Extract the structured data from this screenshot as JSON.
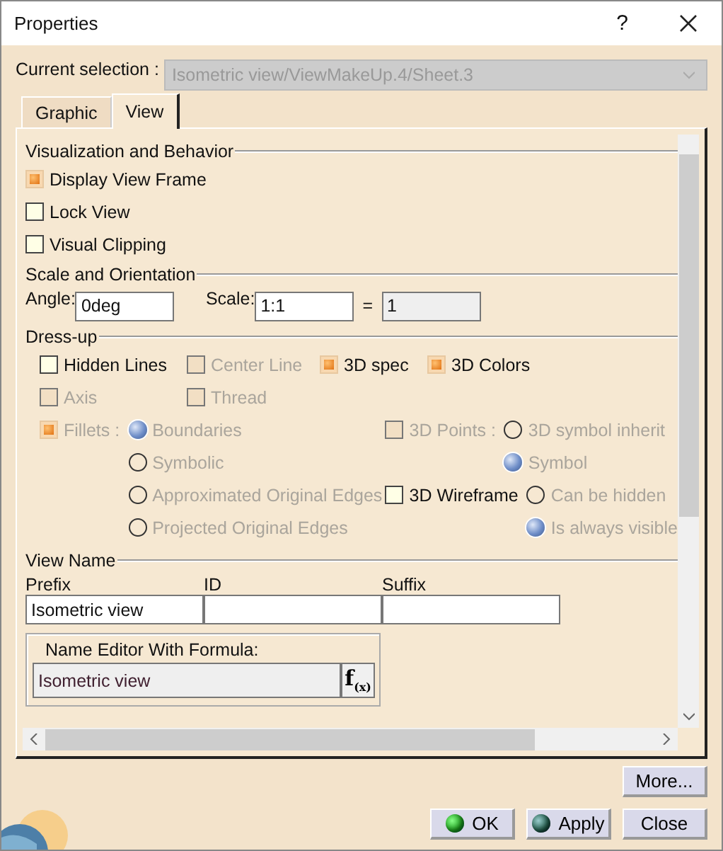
{
  "window": {
    "title": "Properties",
    "help": "?"
  },
  "current_selection": {
    "label": "Current selection :",
    "value": "Isometric view/ViewMakeUp.4/Sheet.3",
    "disabled": true
  },
  "tabs": [
    {
      "label": "Graphic",
      "selected": false
    },
    {
      "label": "View",
      "selected": true
    }
  ],
  "visualization": {
    "title": "Visualization and Behavior",
    "checkboxes": [
      {
        "label": "Display View Frame",
        "checked": true,
        "disabled": false
      },
      {
        "label": "Lock View",
        "checked": false,
        "disabled": false
      },
      {
        "label": "Visual Clipping",
        "checked": false,
        "disabled": false
      }
    ]
  },
  "scale": {
    "title": "Scale and Orientation",
    "angle_label": "Angle:",
    "angle_value": "0deg",
    "scale_label": "Scale:",
    "scale_value": "1:1",
    "equals": "=",
    "result_value": "1"
  },
  "dress_up": {
    "title": "Dress-up",
    "rows": [
      [
        {
          "label": "Hidden Lines",
          "checked": false,
          "disabled": false
        },
        {
          "label": "Center Line",
          "checked": false,
          "disabled": true
        },
        {
          "label": "3D spec",
          "checked": true,
          "disabled": false
        },
        {
          "label": "3D Colors",
          "checked": true,
          "disabled": false
        }
      ],
      [
        {
          "label": "Axis",
          "checked": false,
          "disabled": true
        },
        {
          "label": "Thread",
          "checked": false,
          "disabled": true
        }
      ]
    ],
    "option_groups": [
      {
        "label": "Fillets :",
        "checked": true,
        "disabled": true,
        "options": [
          {
            "label": "Boundaries",
            "selected": true,
            "disabled": true
          },
          {
            "label": "Symbolic",
            "selected": false,
            "disabled": true
          },
          {
            "label": "Approximated Original Edges",
            "selected": false,
            "disabled": true
          },
          {
            "label": "Projected Original Edges",
            "selected": false,
            "disabled": true
          }
        ]
      },
      {
        "label": "3D Points :",
        "checked": false,
        "disabled": true,
        "options": [
          {
            "label": "3D symbol inherit",
            "selected": false,
            "disabled": true
          },
          {
            "label": "Symbol",
            "selected": true,
            "disabled": true
          }
        ]
      },
      {
        "label": "3D Wireframe",
        "checked": false,
        "disabled": false,
        "options": [
          {
            "label": "Can be hidden",
            "selected": false,
            "disabled": true
          },
          {
            "label": "Is always visible",
            "selected": true,
            "disabled": true
          }
        ]
      }
    ]
  },
  "view_name": {
    "title": "View Name",
    "columns": [
      {
        "label": "Prefix",
        "value": "Isometric view"
      },
      {
        "label": "ID"
      },
      {
        "label": "Suffix"
      }
    ],
    "formula": {
      "title": "Name Editor With Formula:",
      "value": "Isometric view",
      "button": "f$_{(x)}$"
    }
  },
  "buttons": {
    "more": "More...",
    "actions": [
      {
        "kind": "ok",
        "label": "OK"
      },
      {
        "kind": "apply",
        "label": "Apply"
      },
      {
        "kind": "plain",
        "label": "Close"
      }
    ]
  }
}
